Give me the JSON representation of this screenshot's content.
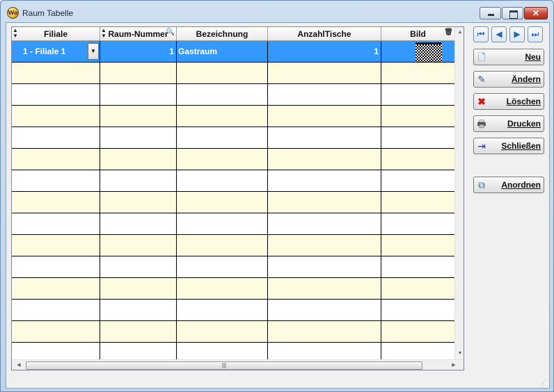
{
  "window": {
    "title": "Raum Tabelle",
    "icon_name": "app-logo-icon",
    "icon_text": "Wo"
  },
  "table": {
    "columns": [
      {
        "label": "Filiale",
        "sortable": true
      },
      {
        "label": "Raum-Nummer",
        "sortable": true,
        "search": true
      },
      {
        "label": "Bezeichnung"
      },
      {
        "label": "AnzahlTische"
      },
      {
        "label": "Bild",
        "trash": true
      }
    ],
    "selected_row": {
      "filiale": "1 - Filiale 1",
      "raum_nummer": "1",
      "bezeichnung": "Gastraum",
      "anzahl_tische": "1",
      "bild_icon": "image-thumbnail"
    },
    "empty_row_count": 14,
    "colors": {
      "selection": "#3399ff",
      "alt_row": "#fefce0",
      "row": "#ffffff"
    }
  },
  "nav": [
    "first-record",
    "previous-record",
    "next-record",
    "last-record"
  ],
  "actions": [
    {
      "id": "neu",
      "label": "Neu",
      "icon": "new-document-icon"
    },
    {
      "id": "aendern",
      "label": "Ändern",
      "icon": "edit-icon"
    },
    {
      "id": "loeschen",
      "label": "Löschen",
      "icon": "delete-icon"
    },
    {
      "id": "drucken",
      "label": "Drucken",
      "icon": "printer-icon"
    },
    {
      "id": "schliessen",
      "label": "Schließen",
      "icon": "exit-door-icon"
    },
    {
      "id": "anordnen",
      "label": "Anordnen",
      "icon": "arrange-icon"
    }
  ]
}
